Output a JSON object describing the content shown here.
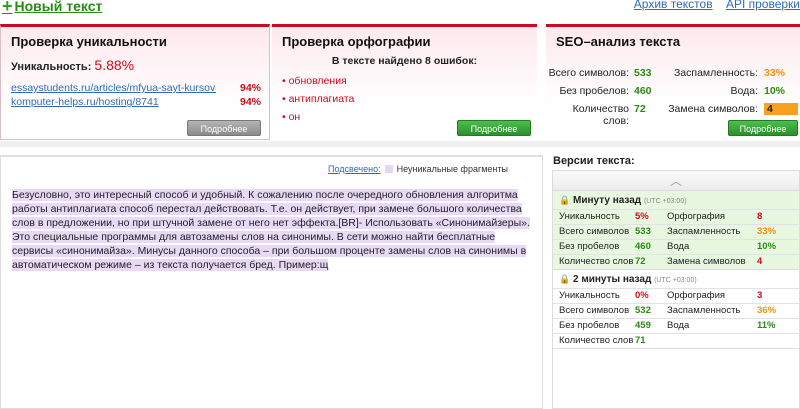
{
  "header": {
    "new_text": "Новый текст",
    "links": [
      "Архив текстов",
      "API проверки"
    ]
  },
  "uniqueness": {
    "title": "Проверка уникальности",
    "label": "Уникальность:",
    "value": "5.88%",
    "sources": [
      {
        "url": "essaystudents.ru/articles/mfyua-sayt-kursova...",
        "pct": "94%"
      },
      {
        "url": "komputer-helps.ru/hosting/8741",
        "pct": "94%"
      }
    ],
    "button": "Подробнее"
  },
  "spelling": {
    "title": "Проверка орфографии",
    "subtitle": "В тексте найдено 8 ошибок:",
    "errors": [
      "обновления",
      "антиплагиата",
      "он"
    ],
    "button": "Подробнее"
  },
  "seo": {
    "title": "SEO–анализ текста",
    "rows": [
      {
        "l1": "Всего символов:",
        "v1": "533",
        "l2": "Заспамленность:",
        "v2": "33%"
      },
      {
        "l1": "Без пробелов:",
        "v1": "460",
        "l2": "Вода:",
        "v2": "10%"
      },
      {
        "l1": "Количество слов:",
        "v1": "72",
        "l2": "Замена символов:",
        "v2": "4"
      }
    ],
    "button": "Подробнее"
  },
  "editor": {
    "legend_label": "Подсвечено:",
    "legend_text": "Неуникальные фрагменты",
    "text": "Безусловно, это интересный способ и удобный. К сожалению после очередного обновления алгоритма работы антиплагиата способ перестал действовать. Т.е. он действует, при замене большого количества слов в предложении, но при штучной замене от него нет эффекта.[BR]- Использовать «Синонимайзеры». Это специальные программы для автозамены слов на синонимы. В сети можно найти бесплатные сервисы «синонимайза». Минусы данного способа – при большом проценте замены слов на синонимы в автоматическом режиме – из текста получается бред.  Пример:щ"
  },
  "versions": {
    "title": "Версии текста:",
    "items": [
      {
        "time": "Минуту назад",
        "tz": "(UTC +03:00)",
        "rows": [
          {
            "l1": "Уникальность",
            "v1": "5%",
            "l2": "Орфография",
            "v2": "8"
          },
          {
            "l1": "Всего символов",
            "v1": "533",
            "l2": "Заспамленность",
            "v2": "33%"
          },
          {
            "l1": "Без пробелов",
            "v1": "460",
            "l2": "Вода",
            "v2": "10%"
          },
          {
            "l1": "Количество слов",
            "v1": "72",
            "l2": "Замена символов",
            "v2": "4"
          }
        ]
      },
      {
        "time": "2 минуты назад",
        "tz": "(UTC +03:00)",
        "rows": [
          {
            "l1": "Уникальность",
            "v1": "0%",
            "l2": "Орфография",
            "v2": "3"
          },
          {
            "l1": "Всего символов",
            "v1": "532",
            "l2": "Заспамленность",
            "v2": "36%"
          },
          {
            "l1": "Без пробелов",
            "v1": "459",
            "l2": "Вода",
            "v2": "11%"
          },
          {
            "l1": "Количество слов",
            "v1": "71",
            "l2": "",
            "v2": ""
          }
        ]
      }
    ]
  },
  "colors": {
    "accent_red": "#cc0a1f",
    "good_green": "#2a8a16",
    "warn_orange": "#f09010",
    "highlight": "#e8d9f7"
  }
}
